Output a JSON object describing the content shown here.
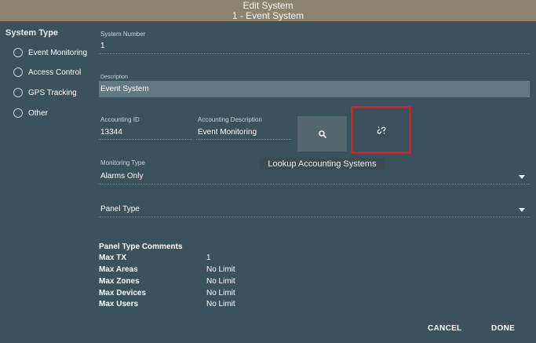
{
  "dialog": {
    "title": "Edit System",
    "subtitle": "1 - Event System"
  },
  "sidebar": {
    "title": "System Type",
    "items": [
      {
        "label": "Event Monitoring"
      },
      {
        "label": "Access Control"
      },
      {
        "label": "GPS Tracking"
      },
      {
        "label": "Other"
      }
    ]
  },
  "form": {
    "system_number": {
      "label": "System Number",
      "value": "1"
    },
    "description": {
      "label": "Description",
      "value": "Event System"
    },
    "accounting_id": {
      "label": "Accounting ID",
      "value": "13344"
    },
    "accounting_description": {
      "label": "Accounting Description",
      "value": "Event Monitoring"
    },
    "monitoring_type": {
      "label": "Monitoring Type",
      "value": "Alarms Only"
    },
    "panel_type": {
      "label": "Panel Type",
      "value": ""
    }
  },
  "buttons": {
    "search_icon": "search-icon",
    "link_icon": "unlink-icon",
    "highlight_color": "#e11c1c"
  },
  "tooltip": "Lookup Accounting Systems",
  "panel_comments": {
    "title": "Panel Type Comments",
    "rows": [
      {
        "key": "Max TX",
        "value": "1"
      },
      {
        "key": "Max Areas",
        "value": "No Limit"
      },
      {
        "key": "Max Zones",
        "value": "No Limit"
      },
      {
        "key": "Max Devices",
        "value": "No Limit"
      },
      {
        "key": "Max Users",
        "value": "No Limit"
      }
    ]
  },
  "footer": {
    "cancel": "CANCEL",
    "done": "DONE"
  }
}
